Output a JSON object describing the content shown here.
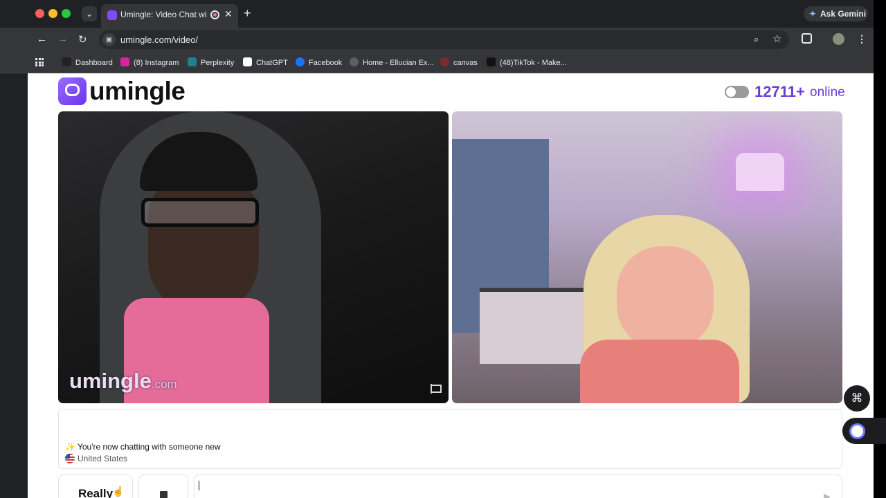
{
  "browser": {
    "tab_title": "Umingle: Video Chat with",
    "url": "umingle.com/video/",
    "gemini_label": "Ask Gemini",
    "bookmarks": [
      {
        "label": "Dashboard",
        "color": "#222222"
      },
      {
        "label": "(8) Instagram",
        "color": "#d6249f"
      },
      {
        "label": "Perplexity",
        "color": "#20808d"
      },
      {
        "label": "ChatGPT",
        "color": "#ffffff"
      },
      {
        "label": "Facebook",
        "color": "#1877f2"
      },
      {
        "label": "Home - Ellucian Ex...",
        "color": "#5b5f66"
      },
      {
        "label": "canvas",
        "color": "#e13f2b"
      },
      {
        "label": "(48)TikTok - Make...",
        "color": "#111111"
      }
    ]
  },
  "site": {
    "logo_text": "umingle",
    "online_count": "12711+",
    "online_label": "online",
    "watermark_main": "umingle",
    "watermark_domain": ".com",
    "accent_color": "#6b3fd6"
  },
  "chat": {
    "message": "You're now chatting with someone new",
    "country": "United States",
    "really_label": "Really",
    "input_value": ""
  }
}
